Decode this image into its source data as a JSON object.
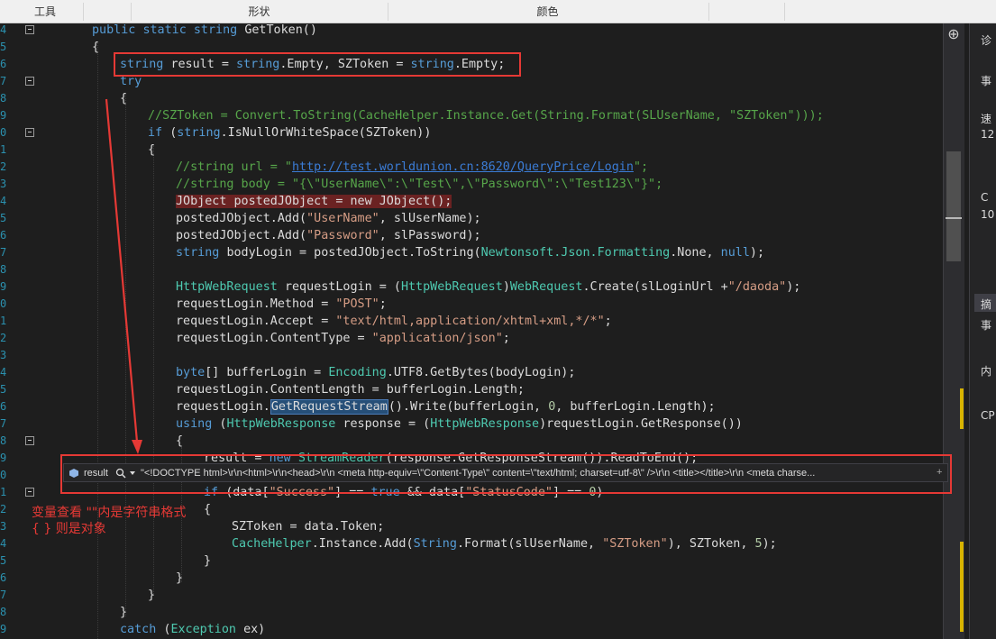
{
  "toolbar": {
    "tools_label": "工具",
    "shapes_label": "形状",
    "colors_label": "颜色"
  },
  "editor": {
    "lines": [
      {
        "n": "4",
        "indent": 102,
        "tokens": [
          [
            "kw",
            "public "
          ],
          [
            "kw",
            "static "
          ],
          [
            "kw",
            "string "
          ],
          [
            "",
            "GetToken()"
          ]
        ]
      },
      {
        "n": "5",
        "indent": 102,
        "tokens": [
          [
            "",
            "{"
          ]
        ]
      },
      {
        "n": "6",
        "indent": 133,
        "tokens": [
          [
            "kw",
            "string "
          ],
          [
            "",
            "result = "
          ],
          [
            "kw",
            "string"
          ],
          [
            "",
            ".Empty, SZToken = "
          ],
          [
            "kw",
            "string"
          ],
          [
            "",
            ".Empty;"
          ]
        ]
      },
      {
        "n": "7",
        "indent": 133,
        "tokens": [
          [
            "kw",
            "try"
          ]
        ]
      },
      {
        "n": "8",
        "indent": 133,
        "tokens": [
          [
            "",
            "{"
          ]
        ]
      },
      {
        "n": "9",
        "indent": 164,
        "tokens": [
          [
            "cm",
            "//SZToken = Convert.ToString(CacheHelper.Instance.Get(String.Format(SLUserName, \"SZToken\")));"
          ]
        ]
      },
      {
        "n": "0",
        "indent": 164,
        "tokens": [
          [
            "kw",
            "if "
          ],
          [
            "",
            "("
          ],
          [
            "kw",
            "string"
          ],
          [
            "",
            ".IsNullOrWhiteSpace(SZToken))"
          ]
        ]
      },
      {
        "n": "1",
        "indent": 164,
        "tokens": [
          [
            "",
            "{"
          ]
        ]
      },
      {
        "n": "2",
        "indent": 195,
        "tokens": [
          [
            "cm",
            "//string url = \""
          ],
          [
            "url",
            "http://test.worldunion.cn:8620/QueryPrice/Login"
          ],
          [
            "cm",
            "\";"
          ]
        ]
      },
      {
        "n": "3",
        "indent": 195,
        "tokens": [
          [
            "cm",
            "//string body = \"{\\\"UserName\\\":\\\"Test\\\",\\\"Password\\\":\\\"Test123\\\"}\";"
          ]
        ]
      },
      {
        "n": "4",
        "indent": 195,
        "tokens": [
          [
            "hl",
            "JObject postedJObject = new JObject();"
          ]
        ]
      },
      {
        "n": "5",
        "indent": 195,
        "tokens": [
          [
            "",
            "postedJObject.Add("
          ],
          [
            "st",
            "\"UserName\""
          ],
          [
            "",
            ", slUserName);"
          ]
        ]
      },
      {
        "n": "6",
        "indent": 195,
        "tokens": [
          [
            "",
            "postedJObject.Add("
          ],
          [
            "st",
            "\"Password\""
          ],
          [
            "",
            ", slPassword);"
          ]
        ]
      },
      {
        "n": "7",
        "indent": 195,
        "tokens": [
          [
            "kw",
            "string "
          ],
          [
            "",
            "bodyLogin = postedJObject.ToString("
          ],
          [
            "ty",
            "Newtonsoft.Json.Formatting"
          ],
          [
            "",
            ".None, "
          ],
          [
            "kw",
            "null"
          ],
          [
            "",
            ");"
          ]
        ]
      },
      {
        "n": "8",
        "indent": 195,
        "tokens": []
      },
      {
        "n": "9",
        "indent": 195,
        "tokens": [
          [
            "ty",
            "HttpWebRequest "
          ],
          [
            "",
            "requestLogin = ("
          ],
          [
            "ty",
            "HttpWebRequest"
          ],
          [
            "",
            ")"
          ],
          [
            "ty",
            "WebRequest"
          ],
          [
            "",
            ".Create(slLoginUrl +"
          ],
          [
            "st",
            "\"/daoda\""
          ],
          [
            "",
            ");"
          ]
        ]
      },
      {
        "n": "0",
        "indent": 195,
        "tokens": [
          [
            "",
            "requestLogin.Method = "
          ],
          [
            "st",
            "\"POST\""
          ],
          [
            "",
            ";"
          ]
        ]
      },
      {
        "n": "1",
        "indent": 195,
        "tokens": [
          [
            "",
            "requestLogin.Accept = "
          ],
          [
            "st",
            "\"text/html,application/xhtml+xml,*/*\""
          ],
          [
            "",
            ";"
          ]
        ]
      },
      {
        "n": "2",
        "indent": 195,
        "tokens": [
          [
            "",
            "requestLogin.ContentType = "
          ],
          [
            "st",
            "\"application/json\""
          ],
          [
            "",
            ";"
          ]
        ]
      },
      {
        "n": "3",
        "indent": 195,
        "tokens": []
      },
      {
        "n": "4",
        "indent": 195,
        "tokens": [
          [
            "kw",
            "byte"
          ],
          [
            "",
            "[] bufferLogin = "
          ],
          [
            "ty",
            "Encoding"
          ],
          [
            "",
            ".UTF8.GetBytes(bodyLogin);"
          ]
        ]
      },
      {
        "n": "5",
        "indent": 195,
        "tokens": [
          [
            "",
            "requestLogin.ContentLength = bufferLogin.Length;"
          ]
        ]
      },
      {
        "n": "6",
        "indent": 195,
        "tokens": [
          [
            "",
            "requestLogin."
          ],
          [
            "sel",
            "GetRequestStream"
          ],
          [
            "",
            "().Write(bufferLogin, "
          ],
          [
            "nm",
            "0"
          ],
          [
            "",
            ", bufferLogin.Length);"
          ]
        ]
      },
      {
        "n": "7",
        "indent": 195,
        "tokens": [
          [
            "kw",
            "using "
          ],
          [
            "",
            "("
          ],
          [
            "ty",
            "HttpWebResponse "
          ],
          [
            "",
            "response = ("
          ],
          [
            "ty",
            "HttpWebResponse"
          ],
          [
            "",
            ")requestLogin.GetResponse())"
          ]
        ]
      },
      {
        "n": "8",
        "indent": 195,
        "tokens": [
          [
            "",
            "{"
          ]
        ]
      },
      {
        "n": "9",
        "indent": 226,
        "tokens": [
          [
            "",
            "result = "
          ],
          [
            "kw",
            "new "
          ],
          [
            "ty",
            "StreamReader"
          ],
          [
            "",
            "(response.GetResponseStream()).ReadToEnd();"
          ]
        ]
      },
      {
        "n": "0",
        "indent": 226,
        "tokens": []
      },
      {
        "n": "1",
        "indent": 226,
        "tokens": [
          [
            "kw",
            "if "
          ],
          [
            "",
            "(data["
          ],
          [
            "st",
            "\"Success\""
          ],
          [
            "",
            "] == "
          ],
          [
            "kw",
            "true "
          ],
          [
            "",
            "&& data["
          ],
          [
            "st",
            "\"StatusCode\""
          ],
          [
            "",
            "] == "
          ],
          [
            "nm",
            "0"
          ],
          [
            "",
            ")"
          ]
        ]
      },
      {
        "n": "2",
        "indent": 226,
        "tokens": [
          [
            "",
            "{"
          ]
        ]
      },
      {
        "n": "3",
        "indent": 257,
        "tokens": [
          [
            "",
            "SZToken = data.Token;"
          ]
        ]
      },
      {
        "n": "4",
        "indent": 257,
        "tokens": [
          [
            "ty",
            "CacheHelper"
          ],
          [
            "",
            ".Instance.Add("
          ],
          [
            "kw",
            "String"
          ],
          [
            "",
            ".Format(slUserName, "
          ],
          [
            "st",
            "\"SZToken\""
          ],
          [
            "",
            "), SZToken, "
          ],
          [
            "nm",
            "5"
          ],
          [
            "",
            ");"
          ]
        ]
      },
      {
        "n": "5",
        "indent": 226,
        "tokens": [
          [
            "",
            "}"
          ]
        ]
      },
      {
        "n": "6",
        "indent": 195,
        "tokens": [
          [
            "",
            "}"
          ]
        ]
      },
      {
        "n": "7",
        "indent": 164,
        "tokens": [
          [
            "",
            "}"
          ]
        ]
      },
      {
        "n": "8",
        "indent": 133,
        "tokens": [
          [
            "",
            "}"
          ]
        ]
      },
      {
        "n": "9",
        "indent": 133,
        "tokens": [
          [
            "kw",
            "catch "
          ],
          [
            "",
            "("
          ],
          [
            "ty",
            "Exception "
          ],
          [
            "",
            "ex)"
          ]
        ]
      },
      {
        "n": "0",
        "indent": 133,
        "tokens": [
          [
            "",
            "{"
          ]
        ]
      }
    ]
  },
  "datatip": {
    "name": "result",
    "value": "\"<!DOCTYPE html>\\r\\n<html>\\r\\n<head>\\r\\n    <meta http-equiv=\\\"Content-Type\\\" content=\\\"text/html; charset=utf-8\\\" />\\r\\n    <title></title>\\r\\n    <meta charse...",
    "expand": "+"
  },
  "annotation": {
    "line1": "变量查看 \"\"内是字符串格式",
    "line2": "{ } 则是对象"
  },
  "right_panel": {
    "items": [
      "诊",
      "事",
      "速",
      "12",
      "C",
      "10",
      "摘",
      "事",
      "内",
      "CP"
    ]
  },
  "split_glyph": "⊕",
  "colors": {
    "red": "#e53935",
    "keyword": "#569cd6",
    "type": "#4ec9b0",
    "string": "#d69d85",
    "comment": "#57a64a"
  }
}
